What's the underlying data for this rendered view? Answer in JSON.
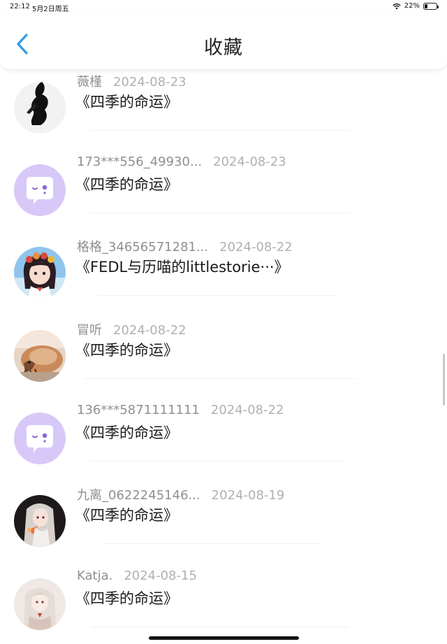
{
  "status_bar": {
    "time": "22:12",
    "date": "5月2日周五",
    "battery": "22%",
    "battery_level": 0.22
  },
  "nav": {
    "title": "收藏"
  },
  "items": [
    {
      "user": "薇槿",
      "date": "2024-08-23",
      "title": "《四季的命运》",
      "avatar": "silhouette"
    },
    {
      "user": "173***556_49930...",
      "date": "2024-08-23",
      "title": "《四季的命运》",
      "avatar": "default-chat"
    },
    {
      "user": "格格_34656571281...",
      "date": "2024-08-22",
      "title": "《FEDL与历喵的littlestorie···》",
      "avatar": "anime-girl"
    },
    {
      "user": "冒听",
      "date": "2024-08-22",
      "title": "《四季的命运》",
      "avatar": "hermit-crab"
    },
    {
      "user": "136***5871111111",
      "date": "2024-08-22",
      "title": "《四季的命运》",
      "avatar": "default-chat"
    },
    {
      "user": "九离_0622245146...",
      "date": "2024-08-19",
      "title": "《四季的命运》",
      "avatar": "dark-anime"
    },
    {
      "user": "Katja.",
      "date": "2024-08-15",
      "title": "《四季的命运》",
      "avatar": "light-anime"
    }
  ],
  "colors": {
    "accent": "#2f9be8",
    "chat_avatar_bg": "#d8c8f8",
    "chat_avatar_eye": "#8a66d6"
  }
}
